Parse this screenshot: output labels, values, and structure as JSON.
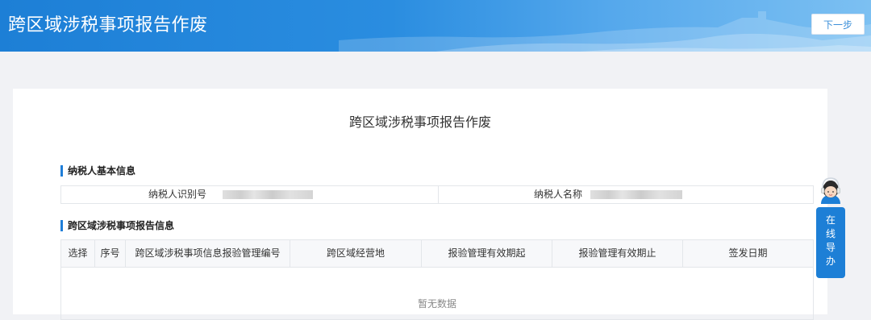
{
  "header": {
    "title": "跨区域涉税事项报告作废",
    "next_button": "下一步"
  },
  "page": {
    "title": "跨区域涉税事项报告作废"
  },
  "taxpayer_section": {
    "title": "纳税人基本信息",
    "id_label": "纳税人识别号",
    "name_label": "纳税人名称"
  },
  "report_section": {
    "title": "跨区域涉税事项报告信息",
    "columns": [
      "选择",
      "序号",
      "跨区域涉税事项信息报验管理编号",
      "跨区域经营地",
      "报验管理有效期起",
      "报验管理有效期止",
      "签发日期"
    ],
    "empty_text": "暂无数据"
  },
  "online_guide": {
    "chars": [
      "在",
      "线",
      "导",
      "办"
    ],
    "icon": "customer-service-avatar-icon"
  },
  "colors": {
    "accent": "#1d7fd6",
    "header_gradient_end": "#7cc0f2"
  }
}
